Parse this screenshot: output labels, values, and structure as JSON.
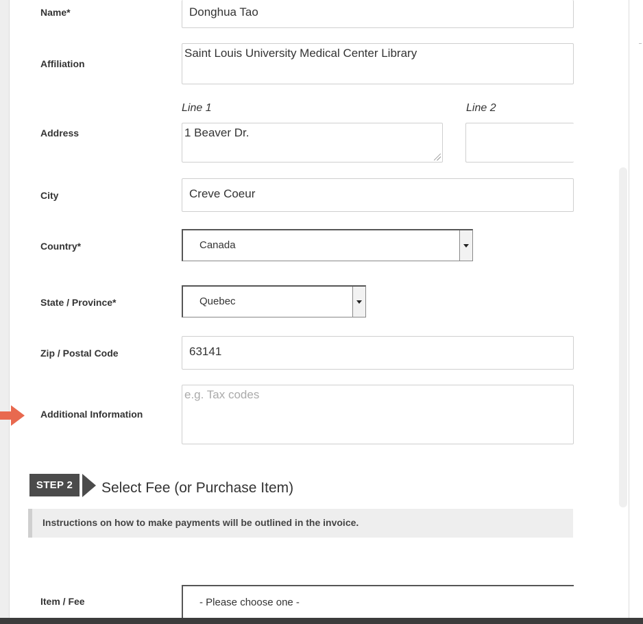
{
  "form": {
    "name": {
      "label": "Name*",
      "value": "Donghua Tao"
    },
    "affiliation": {
      "label": "Affiliation",
      "value": "Saint Louis University Medical Center Library"
    },
    "address": {
      "label": "Address",
      "line1_label": "Line 1",
      "line2_label": "Line 2",
      "line1_value": "1 Beaver Dr.",
      "line2_value": ""
    },
    "city": {
      "label": "City",
      "value": "Creve Coeur"
    },
    "country": {
      "label": "Country*",
      "selected": "Canada"
    },
    "state": {
      "label": "State / Province*",
      "selected": "Quebec"
    },
    "zip": {
      "label": "Zip / Postal Code",
      "value": "63141"
    },
    "additional": {
      "label": "Additional Information",
      "placeholder": "e.g. Tax codes"
    }
  },
  "step2": {
    "badge": "STEP 2",
    "title": "Select Fee (or Purchase Item)",
    "notice": "Instructions on how to make payments will be outlined in the invoice.",
    "item_label": "Item / Fee",
    "item_selected": "- Please choose one -"
  },
  "colors": {
    "arrow": "#e8694f",
    "badge": "#4b4b4b"
  },
  "icons": {
    "arrow": "arrow-right-icon",
    "dropdown": "chevron-down-icon",
    "resize": "resize-grip-icon"
  }
}
